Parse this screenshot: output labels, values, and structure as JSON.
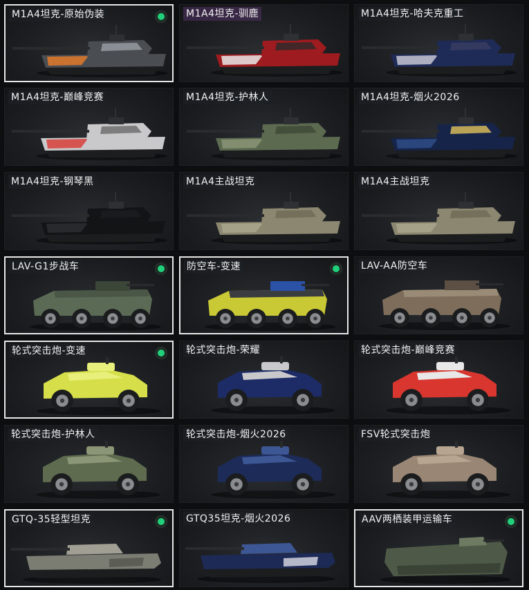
{
  "items": [
    {
      "title": "M1A4坦克-原始伪装",
      "selected": true,
      "owned": true,
      "kind": "tank",
      "c1": "#4a4d52",
      "c2": "#e07a2c",
      "c3": "#9aa0a8"
    },
    {
      "title": "M1A4坦克-驯鹿",
      "selected": false,
      "owned": false,
      "kind": "tank",
      "c1": "#9e1b1f",
      "c2": "#e8e8e8",
      "c3": "#2a2a2a"
    },
    {
      "title": "M1A4坦克-哈夫克重工",
      "selected": false,
      "owned": false,
      "kind": "tank",
      "c1": "#1f2b57",
      "c2": "#c7c7d4",
      "c3": "#3a3f62"
    },
    {
      "title": "M1A4坦克-巅峰竞赛",
      "selected": false,
      "owned": false,
      "kind": "tank",
      "c1": "#c9c9cc",
      "c2": "#d8403a",
      "c3": "#6a6a6a"
    },
    {
      "title": "M1A4坦克-护林人",
      "selected": false,
      "owned": false,
      "kind": "tank",
      "c1": "#5c6a50",
      "c2": "#8a9476",
      "c3": "#3e4836"
    },
    {
      "title": "M1A4坦克-烟火2026",
      "selected": false,
      "owned": false,
      "kind": "tank",
      "c1": "#16244a",
      "c2": "#2e4c86",
      "c3": "#e2c35a"
    },
    {
      "title": "M1A4坦克-钢琴黑",
      "selected": false,
      "owned": false,
      "kind": "tank",
      "c1": "#131416",
      "c2": "#2b2d30",
      "c3": "#1c1d20"
    },
    {
      "title": "M1A4主战坦克",
      "selected": false,
      "owned": false,
      "kind": "tank",
      "c1": "#8c8770",
      "c2": "#a9a58c",
      "c3": "#6e6a58"
    },
    {
      "title": "M1A4主战坦克",
      "selected": false,
      "owned": false,
      "kind": "tank",
      "c1": "#8c8770",
      "c2": "#a9a58c",
      "c3": "#6e6a58"
    },
    {
      "title": "LAV-G1步战车",
      "selected": true,
      "owned": true,
      "kind": "apc",
      "c1": "#5b6a55",
      "c2": "#4a5746",
      "c3": "#3b4538"
    },
    {
      "title": "防空车-变速",
      "selected": true,
      "owned": true,
      "kind": "apc",
      "c1": "#c9c935",
      "c2": "#3a3d40",
      "c3": "#2c52a8"
    },
    {
      "title": "LAV-AA防空车",
      "selected": false,
      "owned": false,
      "kind": "apc",
      "c1": "#7d6d5a",
      "c2": "#9a8b76",
      "c3": "#5c5044"
    },
    {
      "title": "轮式突击炮-变速",
      "selected": true,
      "owned": true,
      "kind": "car",
      "c1": "#d6df4a",
      "c2": "#e8ef7a",
      "c3": "#2a2c2e"
    },
    {
      "title": "轮式突击炮-荣耀",
      "selected": false,
      "owned": false,
      "kind": "car",
      "c1": "#1d2c66",
      "c2": "#c9c9cc",
      "c3": "#2a2c2e"
    },
    {
      "title": "轮式突击炮-巅峰竞赛",
      "selected": false,
      "owned": false,
      "kind": "car",
      "c1": "#d8362e",
      "c2": "#e8e8e8",
      "c3": "#2a2c2e"
    },
    {
      "title": "轮式突击炮-护林人",
      "selected": false,
      "owned": false,
      "kind": "car",
      "c1": "#5e6b4f",
      "c2": "#8b9676",
      "c3": "#2a2c2e"
    },
    {
      "title": "轮式突击炮-烟火2026",
      "selected": false,
      "owned": false,
      "kind": "car",
      "c1": "#1c2b58",
      "c2": "#3d5694",
      "c3": "#2a2c2e"
    },
    {
      "title": "FSV轮式突击炮",
      "selected": false,
      "owned": false,
      "kind": "car",
      "c1": "#9a8674",
      "c2": "#b7a592",
      "c3": "#2a2c2e"
    },
    {
      "title": "GTQ-35轻型坦克",
      "selected": true,
      "owned": true,
      "kind": "light",
      "c1": "#7b7c72",
      "c2": "#a19f94",
      "c3": "#55564f"
    },
    {
      "title": "GTQ35坦克-烟火2026",
      "selected": false,
      "owned": false,
      "kind": "light",
      "c1": "#1d2a55",
      "c2": "#3d5694",
      "c3": "#dcdce6"
    },
    {
      "title": "AAV两栖装甲运输车",
      "selected": true,
      "owned": true,
      "kind": "aav",
      "c1": "#4e5a47",
      "c2": "#6f7a63",
      "c3": "#3a4336"
    }
  ]
}
